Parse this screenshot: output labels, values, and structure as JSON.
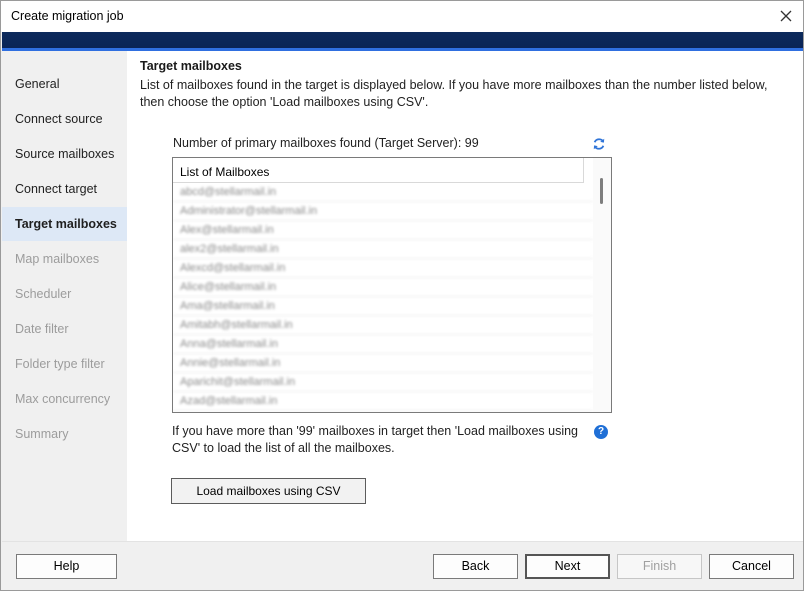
{
  "window": {
    "title": "Create migration job"
  },
  "sidebar": {
    "items": [
      {
        "label": "General",
        "state": "enabled"
      },
      {
        "label": "Connect source",
        "state": "enabled"
      },
      {
        "label": "Source mailboxes",
        "state": "enabled"
      },
      {
        "label": "Connect target",
        "state": "enabled"
      },
      {
        "label": "Target mailboxes",
        "state": "active"
      },
      {
        "label": "Map mailboxes",
        "state": "disabled"
      },
      {
        "label": "Scheduler",
        "state": "disabled"
      },
      {
        "label": "Date filter",
        "state": "disabled"
      },
      {
        "label": "Folder type filter",
        "state": "disabled"
      },
      {
        "label": "Max concurrency",
        "state": "disabled"
      },
      {
        "label": "Summary",
        "state": "disabled"
      }
    ]
  },
  "main": {
    "heading": "Target mailboxes",
    "description": "List of mailboxes found in the target is displayed below. If you have more mailboxes than the number listed below, then choose the option 'Load mailboxes using CSV'.",
    "count_label": "Number of primary mailboxes found (Target Server): 99",
    "refresh_icon": "refresh-icon",
    "list": {
      "header": "List of Mailboxes",
      "rows": [
        "abcd@stellarmail.in",
        "Administrator@stellarmail.in",
        "Alex@stellarmail.in",
        "alex2@stellarmail.in",
        "Alexcd@stellarmail.in",
        "Alice@stellarmail.in",
        "Ama@stellarmail.in",
        "Amitabh@stellarmail.in",
        "Anna@stellarmail.in",
        "Annie@stellarmail.in",
        "Aparichit@stellarmail.in",
        "Azad@stellarmail.in"
      ]
    },
    "info_text": "If you have more than '99' mailboxes in target then 'Load mailboxes using CSV' to load the list of all the mailboxes.",
    "help_icon_glyph": "?",
    "load_button": "Load mailboxes using CSV"
  },
  "footer": {
    "help": "Help",
    "back": "Back",
    "next": "Next",
    "finish": "Finish",
    "cancel": "Cancel"
  },
  "colors": {
    "banner": "#0a2456",
    "accent": "#2f6fe0",
    "active_nav_bg": "#dde8f6",
    "disabled_text": "#9c9c9c"
  }
}
